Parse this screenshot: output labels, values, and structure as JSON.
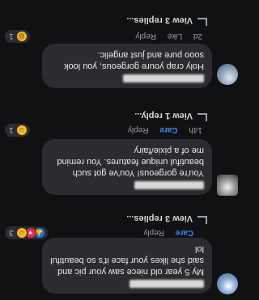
{
  "comments": [
    {
      "text": "My 5 year old niece saw your pic and said she likes your face it's so beautiful lol",
      "time": "",
      "like": "Like",
      "care": "Care",
      "reply": "Reply",
      "reaction_count": "3",
      "replies": "View 3 replies..."
    },
    {
      "text": "You're gorgeous! You've got such beautiful unique features. You remind me of a pixie/fairy",
      "time": "14h",
      "like": "Like",
      "care": "Care",
      "reply": "Reply",
      "reaction_count": "1",
      "replies": "View 1 reply..."
    },
    {
      "text": "Holy crap youre gorgeous, you look sooo pure and just angelic.",
      "time": "2d",
      "like": "Like",
      "care": "",
      "reply": "Reply",
      "reaction_count": "1",
      "replies": "View 3 replies..."
    }
  ],
  "colors": {
    "background": "#101112",
    "bubble": "#2b2c2f",
    "care_accent": "#3b89f5",
    "muted_text": "#9a9ea4"
  },
  "icons": {
    "like": "thumbs-up-icon",
    "love": "heart-icon",
    "care": "care-emoji-icon",
    "haha": "haha-emoji-icon",
    "reply_arrow": "reply-arrow-icon",
    "more": "more-dots-icon"
  }
}
